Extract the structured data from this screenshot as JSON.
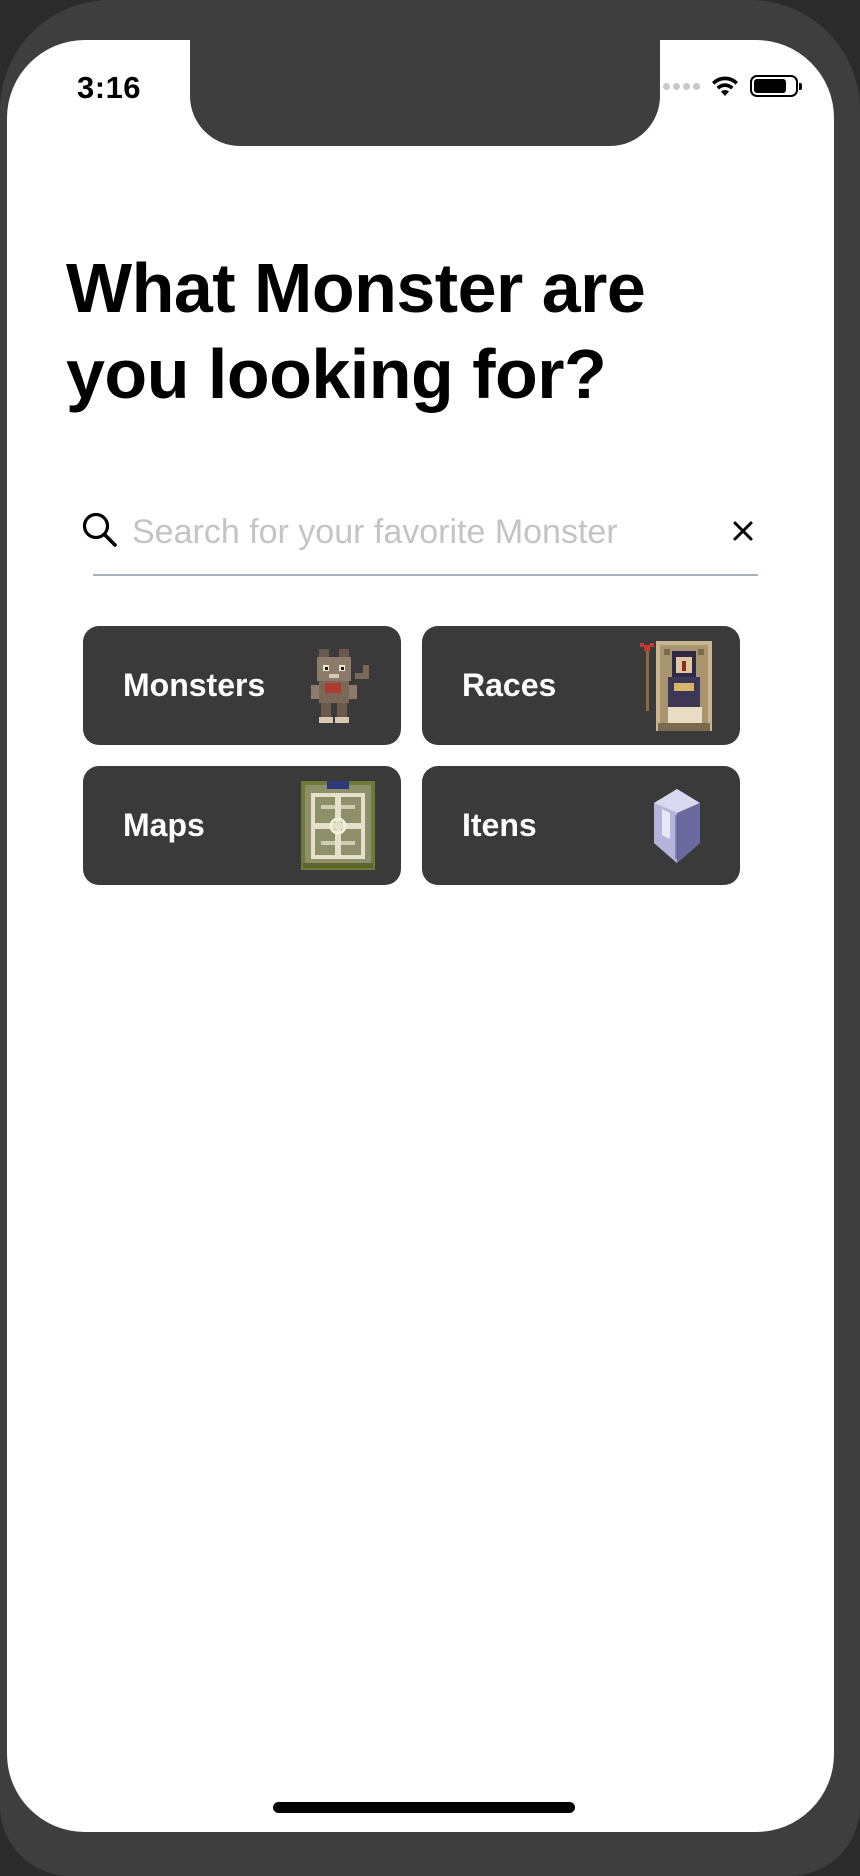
{
  "status_bar": {
    "time": "3:16"
  },
  "headline": "What Monster are you looking for?",
  "search": {
    "placeholder": "Search for your favorite Monster",
    "value": ""
  },
  "categories": [
    {
      "label": "Monsters",
      "icon": "monster-sprite-icon"
    },
    {
      "label": "Races",
      "icon": "pharaoh-sprite-icon"
    },
    {
      "label": "Maps",
      "icon": "map-sprite-icon"
    },
    {
      "label": "Itens",
      "icon": "crystal-sprite-icon"
    }
  ],
  "colors": {
    "card_background": "#3a3a3a",
    "card_text": "#ffffff",
    "placeholder": "#c4c4c4",
    "underline": "#a8b0ba"
  }
}
